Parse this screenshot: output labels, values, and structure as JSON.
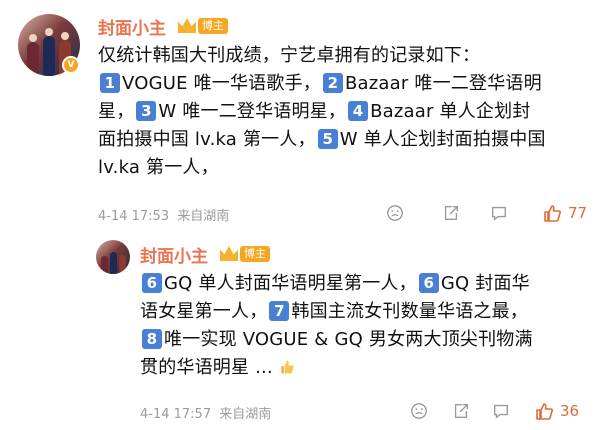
{
  "comments": [
    {
      "username": "封面小主",
      "badge": "博主",
      "avatar_badge": "V",
      "line1": "仅统计韩国大刊成绩，宁艺卓拥有的记录如下：",
      "items_a": [
        {
          "n": "1",
          "text": "VOGUE 唯一华语歌手，"
        },
        {
          "n": "2",
          "text": "Bazaar 唯一二登华语明"
        }
      ],
      "line_b_prefix": "星，",
      "items_b": [
        {
          "n": "3",
          "text": "W 唯一二登华语明星，"
        },
        {
          "n": "4",
          "text": "Bazaar 单人企划封"
        }
      ],
      "line_c_prefix": "面拍摄中国 lv.ka 第一人，",
      "items_c": [
        {
          "n": "5",
          "text": "W 单人企划封面拍摄中国"
        }
      ],
      "line_d": "lv.ka 第一人，",
      "time": "4-14 17:53",
      "location": "来自湖南",
      "likes": "77"
    },
    {
      "username": "封面小主",
      "badge": "博主",
      "line_a": [
        {
          "n": "6",
          "text": "GQ 单人封面华语明星第一人，"
        },
        {
          "n": "6",
          "text": "GQ 封面华"
        }
      ],
      "line_b_prefix": "语女星第一人，",
      "line_b_item": {
        "n": "7",
        "text": "韩国主流女刊数量华语之最，"
      },
      "line_c_item": {
        "n": "8",
        "text": "唯一实现 VOGUE & GQ 男女两大顶尖刊物满"
      },
      "line_d": "贯的华语明星 ...",
      "time": "4-14 17:57",
      "location": "来自湖南",
      "likes": "36"
    }
  ],
  "colors": {
    "accent": "#eb7350",
    "badge": "#f6a623",
    "number_block": "#4a7fd6",
    "meta": "#9b9b9b",
    "like": "#e06b3a"
  },
  "icons": [
    "emoji-icon",
    "share-icon",
    "comment-icon",
    "like-icon",
    "thumbs-up-emoji"
  ]
}
